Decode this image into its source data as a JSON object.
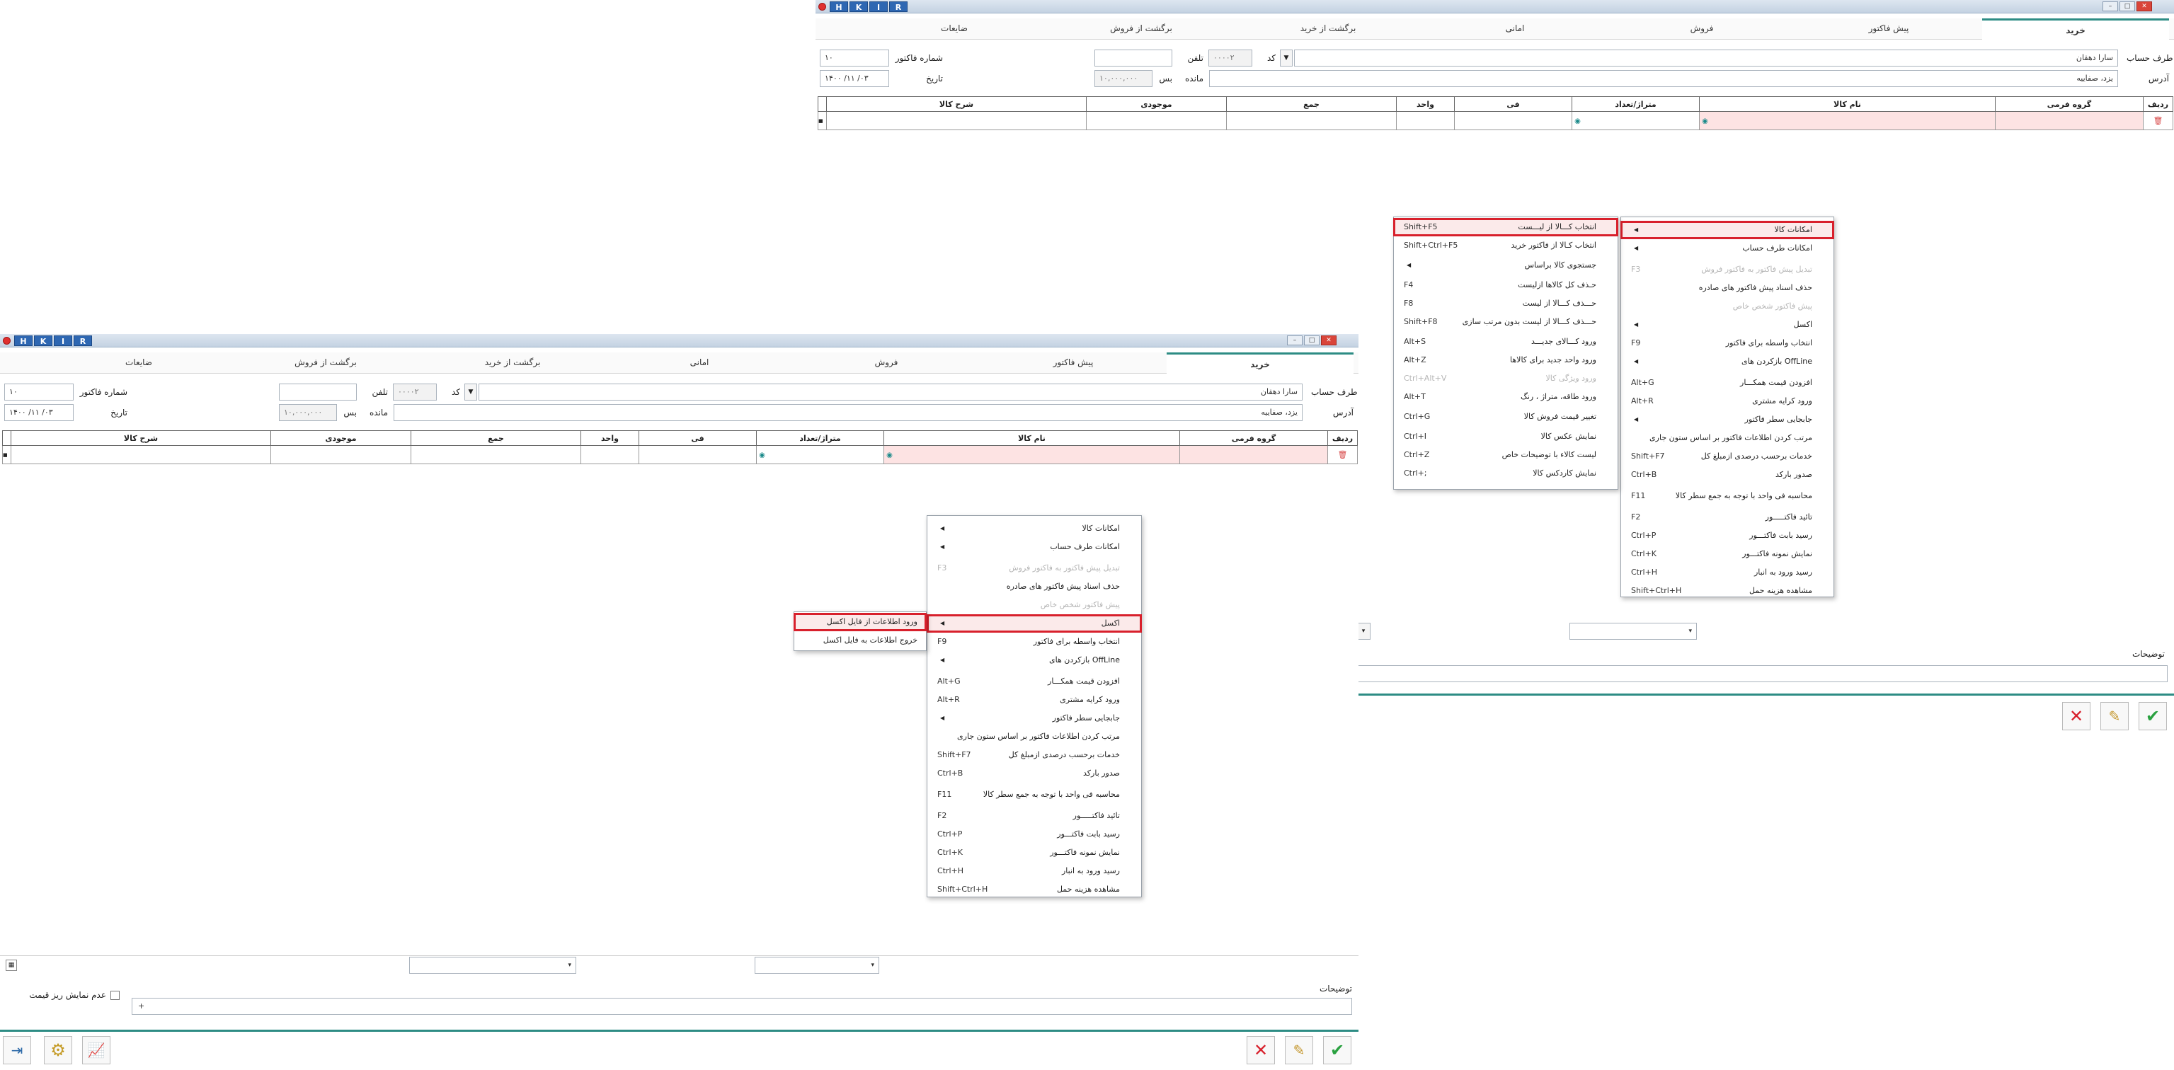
{
  "titlebar": {
    "buttons": [
      "H",
      "K",
      "I",
      "R"
    ]
  },
  "tabs": [
    "خرید",
    "پیش فاکتور",
    "فروش",
    "امانی",
    "برگشت از خرید",
    "برگشت از فروش",
    "ضایعات"
  ],
  "form": {
    "account_label": "طرف حساب",
    "account_value": "سارا دهقان",
    "code_label": "کد",
    "code_value": "۰۰۰۰۲",
    "phone_label": "تلفن",
    "invoice_no_label": "شماره فاکتور",
    "invoice_no_value": "۱۰",
    "address_label": "آدرس",
    "address_value": "یزد، صفاییه",
    "balance_label": "مانده",
    "balance_value": "۱۰,۰۰۰,۰۰۰",
    "balance_type": "بس",
    "date_label": "تاریخ",
    "date_value": "۱۴۰۰ /۱۱ /۰۳"
  },
  "grid": {
    "headers": [
      "ردیف",
      "گروه فرمی",
      "نام کالا",
      "متراژ/تعداد",
      "فی",
      "واحد",
      "جمع",
      "موجودی",
      "شرح کالا"
    ]
  },
  "menu1": [
    {
      "label": "امکانات کالا",
      "arrow": true
    },
    {
      "label": "امکانات طرف حساب",
      "arrow": true
    },
    {
      "label": "تبدیل پیش فاکتور به فاکتور فروش",
      "shortcut": "F3",
      "disabled": true
    },
    {
      "label": "حذف اسناد پیش فاکتور های صادره"
    },
    {
      "label": "پیش فاکتور شخص خاص",
      "disabled": true
    },
    {
      "label": "اکسل",
      "arrow": true
    },
    {
      "label": "انتخاب واسطه برای فاکتور",
      "shortcut": "F9"
    },
    {
      "label": "بازکردن های OffLine",
      "arrow": true
    },
    {
      "label": "افزودن قیمت همکـــار",
      "shortcut": "Alt+G"
    },
    {
      "label": "ورود کرایه مشتری",
      "shortcut": "Alt+R"
    },
    {
      "label": "جابجایی سطر فاکتور",
      "arrow": true
    },
    {
      "label": "مرتب کردن اطلاعات فاکتور بر اساس ستون جاری"
    },
    {
      "label": "خدمات برحسب درصدی ازمبلغ کل",
      "shortcut": "Shift+F7"
    },
    {
      "label": "صدور بارکد",
      "shortcut": "Ctrl+B"
    },
    {
      "label": "محاسبه فی واحد با توجه به جمع سطر کالا",
      "shortcut": "F11"
    },
    {
      "label": "تائید فاکتـــــور",
      "shortcut": "F2"
    },
    {
      "label": "رسید بابت فاکتـــور",
      "shortcut": "Ctrl+P"
    },
    {
      "label": "نمایش نمونه فاکتـــور",
      "shortcut": "Ctrl+K"
    },
    {
      "label": "رسید ورود به انبار",
      "shortcut": "Ctrl+H"
    },
    {
      "label": "مشاهده هزینه حمل",
      "shortcut": "Shift+Ctrl+H"
    }
  ],
  "submenu_goods": [
    {
      "label": "انتخاب کـــالا از لیـــست",
      "shortcut": "Shift+F5"
    },
    {
      "label": "انتخاب کـالا از فاکتور خرید",
      "shortcut": "Shift+Ctrl+F5"
    },
    {
      "label": "جستجوی کالا براساس",
      "arrow": true
    },
    {
      "label": "حـذف کل کالاها ازلیست",
      "shortcut": "F4"
    },
    {
      "label": "حـــذف کـــالا از لیست",
      "shortcut": "F8"
    },
    {
      "label": "حـــذف کـــالا از لیست بدون مرتب سازی",
      "shortcut": "Shift+F8"
    },
    {
      "label": "ورود کـــالای جدیـــد",
      "shortcut": "Alt+S"
    },
    {
      "label": "ورود واحد جدید برای کالاها",
      "shortcut": "Alt+Z"
    },
    {
      "label": "ورود ویژگی کالا",
      "shortcut": "Ctrl+Alt+V",
      "disabled": true
    },
    {
      "label": "ورود طاقه، متراژ ، رنگ",
      "shortcut": "Alt+T"
    },
    {
      "label": "تغییر قیمت فروش کالا",
      "shortcut": "Ctrl+G"
    },
    {
      "label": "نمایش عکس کالا",
      "shortcut": "Ctrl+I"
    },
    {
      "label": "لیست کالاء با توضیحات خاص",
      "shortcut": "Ctrl+Z"
    },
    {
      "label": "نمایش کاردکس کالا",
      "shortcut": "Ctrl+;"
    }
  ],
  "submenu_excel": [
    {
      "label": "ورود اطلاعات از فایل اکسل"
    },
    {
      "label": "خروج اطلاعات به فایل اکسل"
    }
  ],
  "footer": {
    "description_label": "توضیحات",
    "description_value": "+",
    "hide_price_label": "عدم نمایش ریز قیمت"
  },
  "colors": {
    "accent": "#2d8c84",
    "highlight": "#d8202c",
    "title_button": "#2e67b2"
  }
}
